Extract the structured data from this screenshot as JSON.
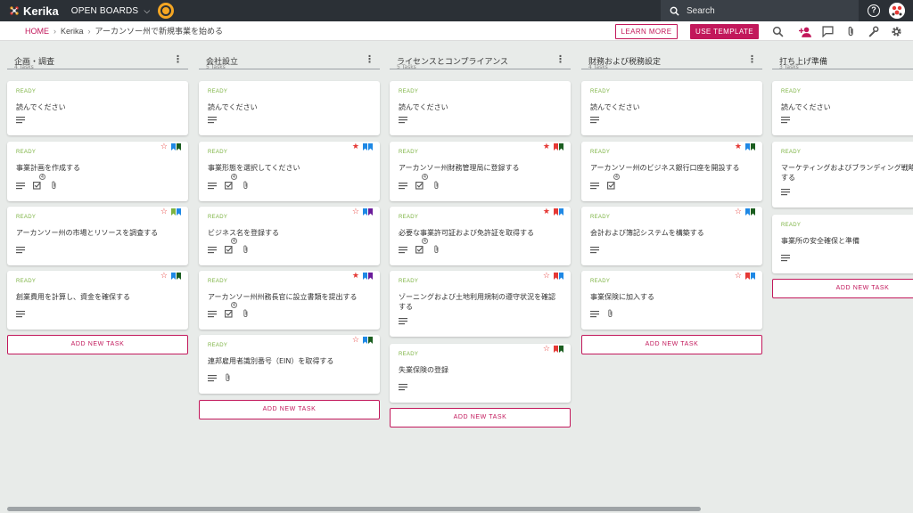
{
  "app": {
    "name": "Kerika",
    "open_boards_label": "OPEN BOARDS",
    "search_placeholder": "Search"
  },
  "breadcrumb": {
    "home": "HOME",
    "parent": "Kerika",
    "current": "アーカンソー州で新規事業を始める"
  },
  "actions": {
    "learn_more": "LEARN MORE",
    "use_template": "USE TEMPLATE"
  },
  "colors": {
    "accent": "#c2185b",
    "ready": "#7cb342",
    "red": "#e53935",
    "blue": "#1e88e5",
    "green": "#1b5e20",
    "purple": "#6a1b9a",
    "lightgreen": "#7cb342"
  },
  "columns": [
    {
      "title": "企画・調査",
      "count": "4 Tasks",
      "add_label": "ADD NEW TASK",
      "cards": [
        {
          "status": "READY",
          "title": "読んでください",
          "star": "",
          "flags": [],
          "checklist": "",
          "attach": false
        },
        {
          "status": "READY",
          "title": "事業計画を作成する",
          "star": "outline",
          "flags": [
            "blue",
            "green"
          ],
          "checklist": "4",
          "attach": true
        },
        {
          "status": "READY",
          "title": "アーカンソー州の市場とリソースを調査する",
          "star": "outline",
          "flags": [
            "lightgreen",
            "blue"
          ],
          "checklist": "",
          "attach": false
        },
        {
          "status": "READY",
          "title": "創業費用を計算し、資金を確保する",
          "star": "outline",
          "flags": [
            "blue",
            "green"
          ],
          "checklist": "",
          "attach": false
        }
      ]
    },
    {
      "title": "会社設立",
      "count": "5 Tasks",
      "add_label": "ADD NEW TASK",
      "cards": [
        {
          "status": "READY",
          "title": "読んでください",
          "star": "",
          "flags": [],
          "checklist": "",
          "attach": false
        },
        {
          "status": "READY",
          "title": "事業形態を選択してください",
          "star": "filled",
          "flags": [
            "blue",
            "blue"
          ],
          "checklist": "4",
          "attach": true
        },
        {
          "status": "READY",
          "title": "ビジネス名を登録する",
          "star": "outline",
          "flags": [
            "blue",
            "purple"
          ],
          "checklist": "4",
          "attach": true
        },
        {
          "status": "READY",
          "title": "アーカンソー州州務長官に設立書類を提出する",
          "star": "filled",
          "flags": [
            "blue",
            "purple"
          ],
          "checklist": "4",
          "attach": true
        },
        {
          "status": "READY",
          "title": "連邦雇用者識別番号（EIN）を取得する",
          "star": "outline",
          "flags": [
            "blue",
            "green"
          ],
          "checklist": "",
          "attach": true
        }
      ]
    },
    {
      "title": "ライセンスとコンプライアンス",
      "count": "5 Tasks",
      "add_label": "ADD NEW TASK",
      "cards": [
        {
          "status": "READY",
          "title": "読んでください",
          "star": "",
          "flags": [],
          "checklist": "",
          "attach": false
        },
        {
          "status": "READY",
          "title": "アーカンソー州財務管理局に登録する",
          "star": "filled",
          "flags": [
            "red",
            "green"
          ],
          "checklist": "4",
          "attach": true
        },
        {
          "status": "READY",
          "title": "必要な事業許可証および免許証を取得する",
          "star": "filled",
          "flags": [
            "red",
            "blue"
          ],
          "checklist": "4",
          "attach": true
        },
        {
          "status": "READY",
          "title": "ゾーニングおよび土地利用規制の遵守状況を確認する",
          "star": "outline",
          "flags": [
            "red",
            "blue"
          ],
          "checklist": "",
          "attach": false
        },
        {
          "status": "READY",
          "title": "失業保険の登録",
          "star": "outline",
          "flags": [
            "red",
            "green"
          ],
          "checklist": "",
          "attach": false
        }
      ]
    },
    {
      "title": "財務および税務設定",
      "count": "4 Tasks",
      "add_label": "ADD NEW TASK",
      "cards": [
        {
          "status": "READY",
          "title": "読んでください",
          "star": "",
          "flags": [],
          "checklist": "",
          "attach": false
        },
        {
          "status": "READY",
          "title": "アーカンソー州のビジネス銀行口座を開設する",
          "star": "filled",
          "flags": [
            "blue",
            "green"
          ],
          "checklist": "4",
          "attach": false
        },
        {
          "status": "READY",
          "title": "会計および簿記システムを構築する",
          "star": "outline",
          "flags": [
            "blue",
            "green"
          ],
          "checklist": "",
          "attach": false
        },
        {
          "status": "READY",
          "title": "事業保険に加入する",
          "star": "outline",
          "flags": [
            "red",
            "blue"
          ],
          "checklist": "",
          "attach": true
        }
      ]
    },
    {
      "title": "打ち上げ準備",
      "count": "3 Tasks",
      "add_label": "ADD NEW TASK",
      "cards": [
        {
          "status": "READY",
          "title": "読んでください",
          "star": "",
          "flags": [],
          "checklist": "",
          "attach": false
        },
        {
          "status": "READY",
          "title": "マーケティングおよびブランディング戦略を策定する",
          "star": "outline",
          "flags": [
            "blue",
            "green"
          ],
          "checklist": "",
          "attach": false
        },
        {
          "status": "READY",
          "title": "事業所の安全確保と準備",
          "star": "outline",
          "flags": [
            "blue",
            "green"
          ],
          "checklist": "",
          "attach": false
        }
      ]
    }
  ]
}
